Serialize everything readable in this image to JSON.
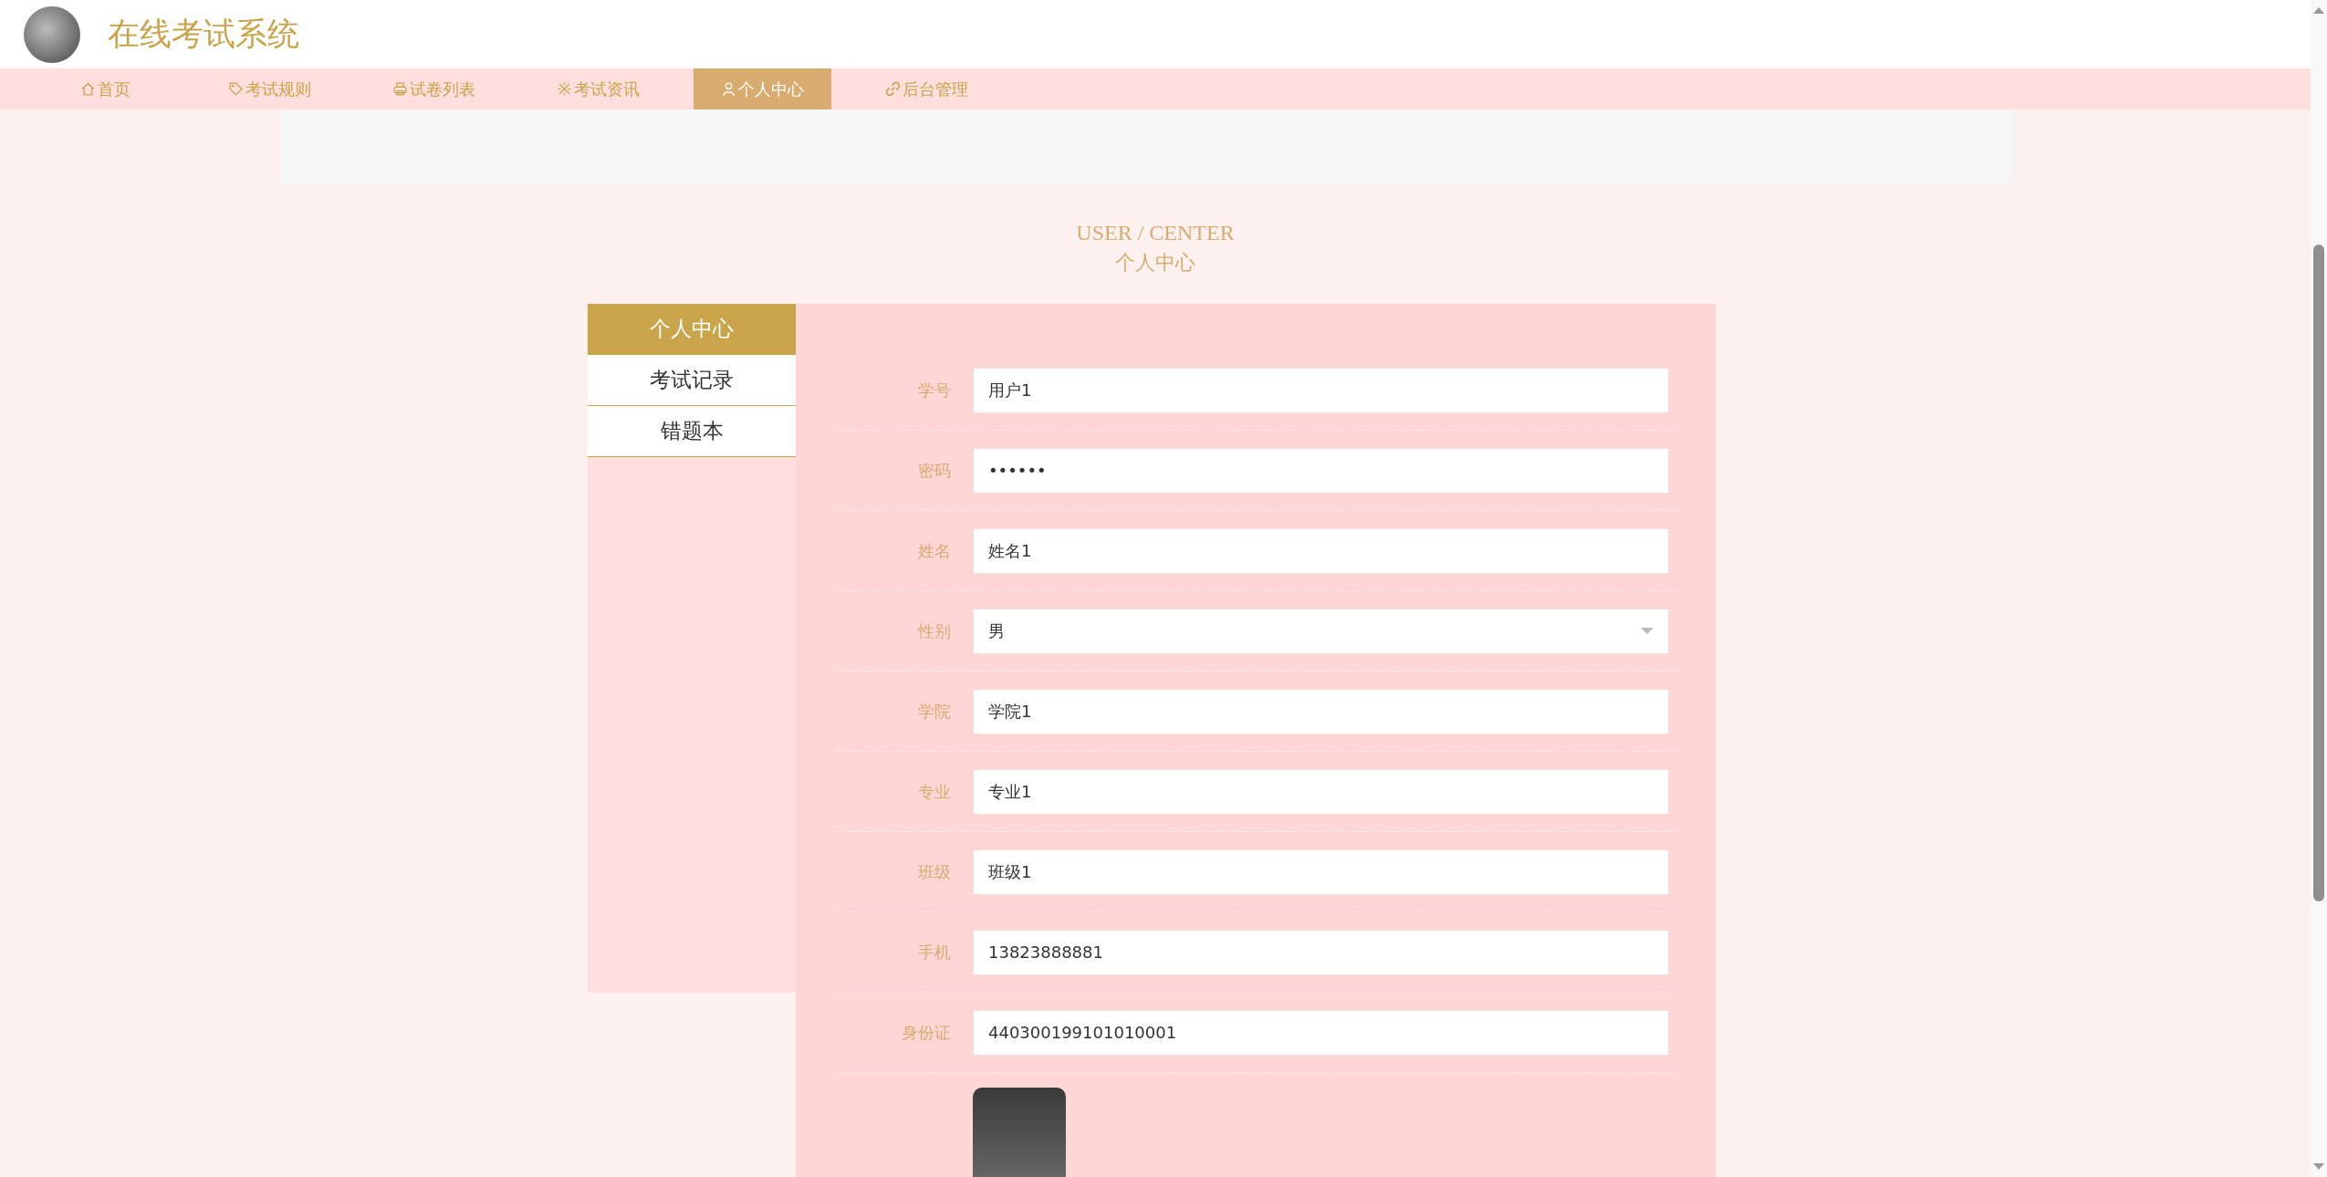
{
  "header": {
    "title": "在线考试系统"
  },
  "nav": [
    {
      "label": "首页",
      "selected": false
    },
    {
      "label": "考试规则",
      "selected": false
    },
    {
      "label": "试卷列表",
      "selected": false
    },
    {
      "label": "考试资讯",
      "selected": false
    },
    {
      "label": "个人中心",
      "selected": true
    },
    {
      "label": "后台管理",
      "selected": false
    }
  ],
  "section": {
    "title_en": "USER / CENTER",
    "title_cn": "个人中心"
  },
  "sidebar": [
    {
      "label": "个人中心",
      "selected": true
    },
    {
      "label": "考试记录",
      "selected": false
    },
    {
      "label": "错题本",
      "selected": false
    }
  ],
  "form": [
    {
      "label": "学号",
      "kind": "text",
      "value": "用户1"
    },
    {
      "label": "密码",
      "kind": "text",
      "value": "••••••"
    },
    {
      "label": "姓名",
      "kind": "text",
      "value": "姓名1"
    },
    {
      "label": "性别",
      "kind": "select",
      "value": "男"
    },
    {
      "label": "学院",
      "kind": "text",
      "value": "学院1"
    },
    {
      "label": "专业",
      "kind": "text",
      "value": "专业1"
    },
    {
      "label": "班级",
      "kind": "text",
      "value": "班级1"
    },
    {
      "label": "手机",
      "kind": "text",
      "value": "13823888881"
    },
    {
      "label": "身份证",
      "kind": "text",
      "value": "440300199101010001"
    },
    {
      "kind": "photo"
    }
  ]
}
